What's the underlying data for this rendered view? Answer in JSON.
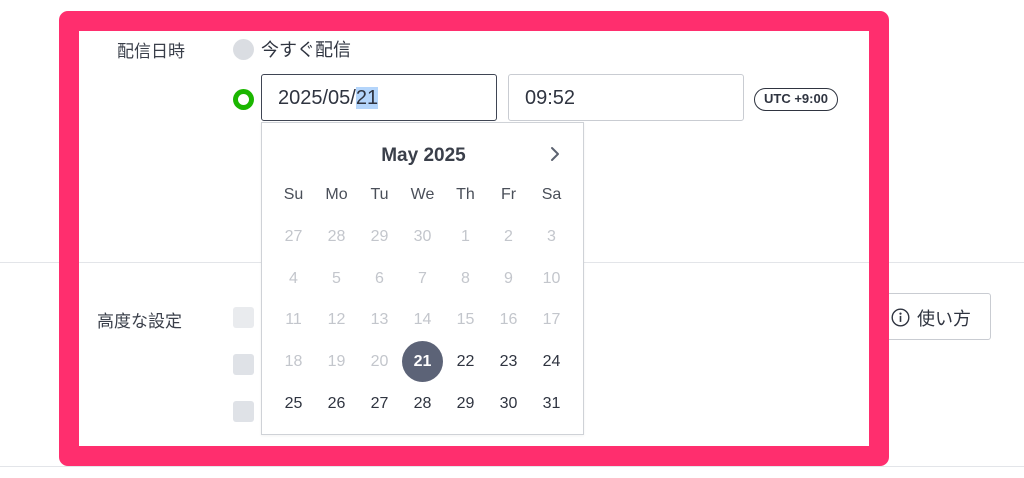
{
  "schedule": {
    "label": "配信日時",
    "now_label": "今すぐ配信",
    "date_prefix": "2025/05/",
    "date_selected": "21",
    "time_value": "09:52",
    "timezone": "UTC +9:00"
  },
  "advanced": {
    "label": "高度な設定",
    "howto_label": "使い方"
  },
  "calendar": {
    "month_label": "May 2025",
    "weekdays": [
      "Su",
      "Mo",
      "Tu",
      "We",
      "Th",
      "Fr",
      "Sa"
    ],
    "weeks": [
      [
        {
          "d": "27",
          "s": "dim"
        },
        {
          "d": "28",
          "s": "dim"
        },
        {
          "d": "29",
          "s": "dim"
        },
        {
          "d": "30",
          "s": "dim"
        },
        {
          "d": "1",
          "s": "dim"
        },
        {
          "d": "2",
          "s": "dim"
        },
        {
          "d": "3",
          "s": "dim"
        }
      ],
      [
        {
          "d": "4",
          "s": "dim"
        },
        {
          "d": "5",
          "s": "dim"
        },
        {
          "d": "6",
          "s": "dim"
        },
        {
          "d": "7",
          "s": "dim"
        },
        {
          "d": "8",
          "s": "dim"
        },
        {
          "d": "9",
          "s": "dim"
        },
        {
          "d": "10",
          "s": "dim"
        }
      ],
      [
        {
          "d": "11",
          "s": "dim"
        },
        {
          "d": "12",
          "s": "dim"
        },
        {
          "d": "13",
          "s": "dim"
        },
        {
          "d": "14",
          "s": "dim"
        },
        {
          "d": "15",
          "s": "dim"
        },
        {
          "d": "16",
          "s": "dim"
        },
        {
          "d": "17",
          "s": "dim"
        }
      ],
      [
        {
          "d": "18",
          "s": "dim"
        },
        {
          "d": "19",
          "s": "dim"
        },
        {
          "d": "20",
          "s": "dim"
        },
        {
          "d": "21",
          "s": "sel"
        },
        {
          "d": "22",
          "s": "cur"
        },
        {
          "d": "23",
          "s": "cur"
        },
        {
          "d": "24",
          "s": "cur"
        }
      ],
      [
        {
          "d": "25",
          "s": "cur"
        },
        {
          "d": "26",
          "s": "cur"
        },
        {
          "d": "27",
          "s": "cur"
        },
        {
          "d": "28",
          "s": "cur"
        },
        {
          "d": "29",
          "s": "cur"
        },
        {
          "d": "30",
          "s": "cur"
        },
        {
          "d": "31",
          "s": "cur"
        }
      ]
    ]
  },
  "colors": {
    "highlight_frame": "#ff2e6e",
    "radio_selected": "#1bb600",
    "selected_day": "#5c6377"
  }
}
